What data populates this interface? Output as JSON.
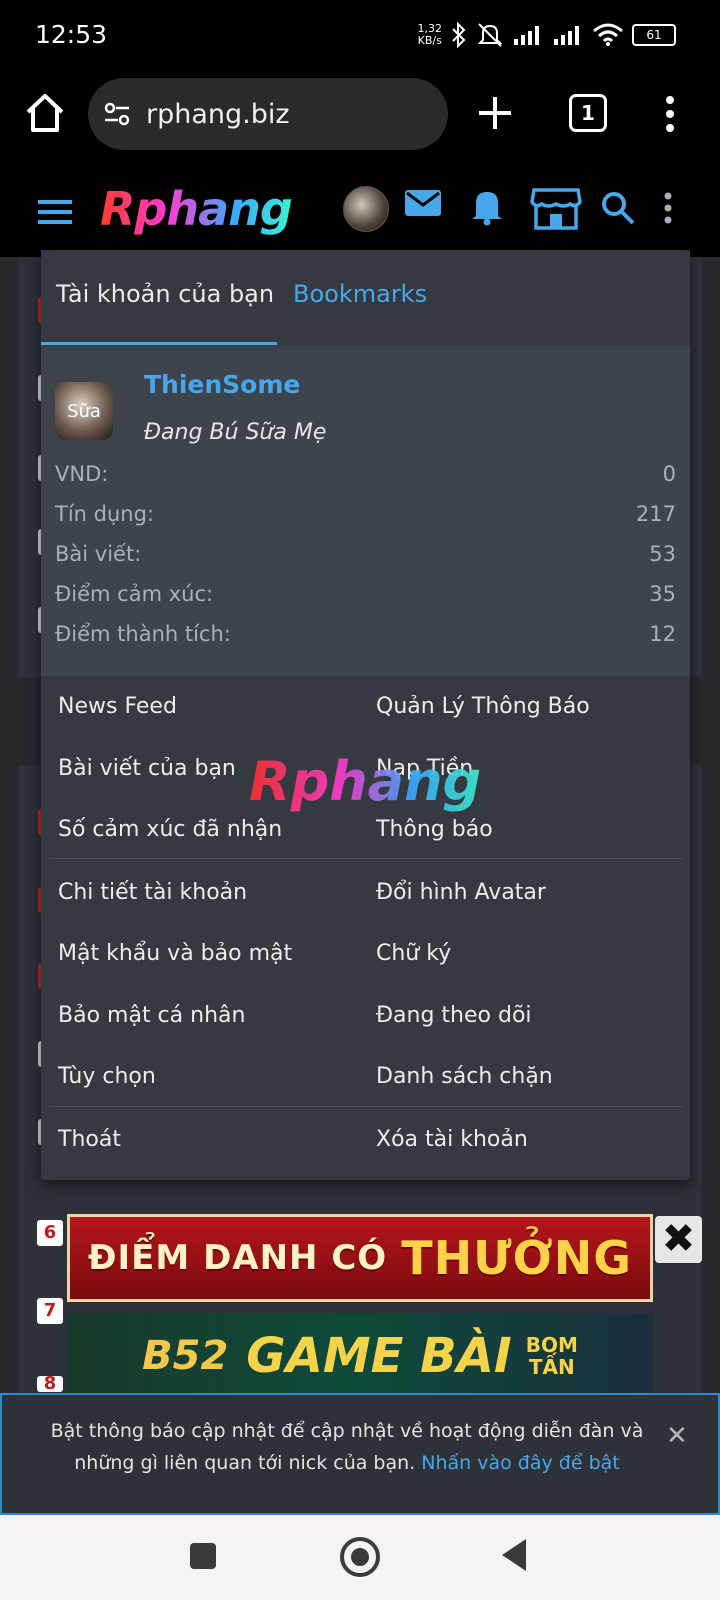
{
  "status_bar": {
    "time": "12:53",
    "net_speed_value": "1,32",
    "net_speed_unit": "KB/s",
    "battery": "61"
  },
  "browser": {
    "url": "rphang.biz",
    "tab_count": "1"
  },
  "site": {
    "logo_text": "Rphang"
  },
  "menu": {
    "tabs": {
      "account": "Tài khoản của bạn",
      "bookmarks": "Bookmarks"
    },
    "profile": {
      "avatar_text": "Sữa",
      "username": "ThienSome",
      "status": "Đang Bú Sữa Mẹ",
      "stats": [
        {
          "label": "VND:",
          "value": "0"
        },
        {
          "label": "Tín dụng:",
          "value": "217"
        },
        {
          "label": "Bài viết:",
          "value": "53"
        },
        {
          "label": "Điểm cảm xúc:",
          "value": "35"
        },
        {
          "label": "Điểm thành tích:",
          "value": "12"
        }
      ]
    },
    "links": {
      "news_feed": "News Feed",
      "manage_notifications": "Quản Lý Thông Báo",
      "your_posts": "Bài viết của bạn",
      "deposit": "Nạp Tiền",
      "reactions_received": "Số cảm xúc đã nhận",
      "notifications": "Thông báo",
      "account_details": "Chi tiết tài khoản",
      "change_avatar": "Đổi hình Avatar",
      "password_security": "Mật khẩu và bảo mật",
      "signature": "Chữ ký",
      "privacy": "Bảo mật cá nhân",
      "following": "Đang theo dõi",
      "preferences": "Tùy chọn",
      "ignore_list": "Danh sách chặn",
      "logout": "Thoát",
      "delete_account": "Xóa tài khoản"
    },
    "watermark": "Rphang"
  },
  "ads": {
    "rank_6": "6",
    "rank_7": "7",
    "rank_8": "8",
    "banner1_small": "ĐIỂM DANH CÓ",
    "banner1_big": "THƯỞNG",
    "banner2_brand": "B52",
    "banner2_main": "GAME BÀI",
    "banner2_side_top": "BOM",
    "banner2_side_bottom": "TẤN",
    "close_label": "✖"
  },
  "notification_prompt": {
    "text": "Bật thông báo cập nhật để cập nhật về hoạt động diễn đàn và những gì liên quan tới nick của bạn.",
    "link": "Nhấn vào đây để bật",
    "close": "✕"
  },
  "colors": {
    "accent": "#47a7eb",
    "panel": "#353a41",
    "profile_bg": "#3e444b"
  }
}
